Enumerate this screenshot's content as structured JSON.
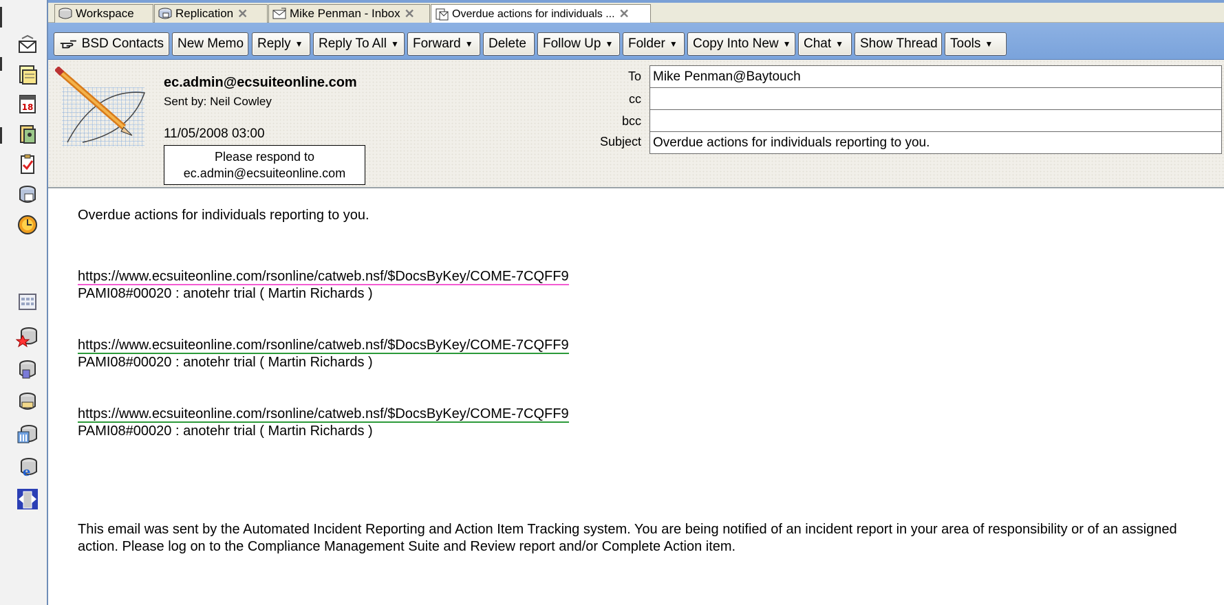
{
  "tabs": [
    {
      "label": "Workspace",
      "icon": "workspace-icon",
      "closable": false,
      "active": false
    },
    {
      "label": "Replication",
      "icon": "replication-icon",
      "closable": true,
      "active": false
    },
    {
      "label": "Mike Penman - Inbox",
      "icon": "mail-icon",
      "closable": true,
      "active": false
    },
    {
      "label": "Overdue actions for individuals ...",
      "icon": "document-icon",
      "closable": true,
      "active": true
    }
  ],
  "toolbar": {
    "bsd_contacts": "BSD Contacts",
    "new_memo": "New Memo",
    "reply": "Reply",
    "reply_to_all": "Reply To All",
    "forward": "Forward",
    "delete": "Delete",
    "follow_up": "Follow Up",
    "folder": "Folder",
    "copy_into_new": "Copy Into New",
    "chat": "Chat",
    "show_thread": "Show Thread",
    "tools": "Tools"
  },
  "header": {
    "from": "ec.admin@ecsuiteonline.com",
    "sent_by": "Sent by: Neil Cowley",
    "date": "11/05/2008 03:00",
    "respond_line1": "Please respond to",
    "respond_line2": "ec.admin@ecsuiteonline.com",
    "labels": {
      "to": "To",
      "cc": "cc",
      "bcc": "bcc",
      "subject": "Subject"
    },
    "to": "Mike Penman@Baytouch",
    "cc": "",
    "bcc": "",
    "subject": "Overdue actions for individuals reporting to you."
  },
  "body": {
    "intro": "Overdue actions for individuals reporting to you.",
    "items": [
      {
        "link": "https://www.ecsuiteonline.com/rsonline/catweb.nsf/$DocsByKey/COME-7CQFF9",
        "desc": "PAMI08#00020 : anotehr trial ( Martin Richards )"
      },
      {
        "link": "https://www.ecsuiteonline.com/rsonline/catweb.nsf/$DocsByKey/COME-7CQFF9",
        "desc": "PAMI08#00020 : anotehr trial ( Martin Richards )"
      },
      {
        "link": "https://www.ecsuiteonline.com/rsonline/catweb.nsf/$DocsByKey/COME-7CQFF9",
        "desc": "PAMI08#00020 : anotehr trial ( Martin Richards )"
      }
    ],
    "footer": "This email was sent by the Automated Incident Reporting and Action Item Tracking system. You are being notified of an incident report in your area of responsibility or of an assigned action. Please log on to the Compliance Management Suite and Review report and/or Complete Action item."
  },
  "dock": [
    "home-icon",
    "mail-icon",
    "calendar-icon",
    "contacts-icon",
    "todo-icon",
    "replicator-icon",
    "sametime-icon",
    "calendar-grid-icon",
    "favorites-icon",
    "database-icon",
    "folder-icon",
    "bookmarks-icon",
    "internet-icon",
    "exit-icon"
  ],
  "colors": {
    "toolbar": "#7aa3db",
    "accent": "#6f8db8",
    "link_underline": "#2b9a39",
    "visited_underline": "#f35bd2"
  }
}
